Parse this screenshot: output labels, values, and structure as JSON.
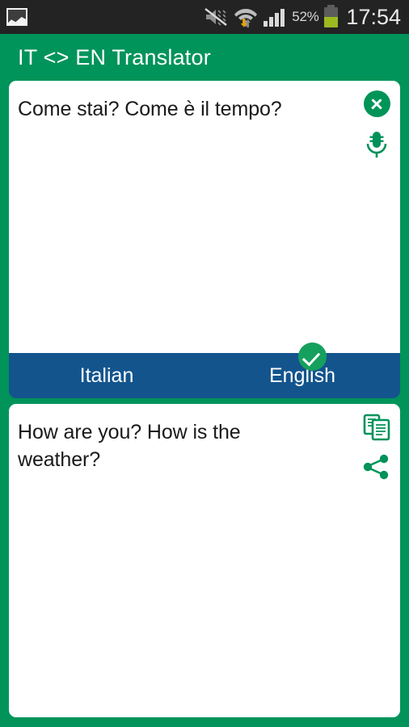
{
  "status_bar": {
    "left_icons": [
      {
        "name": "gallery-icon",
        "label": "gallery"
      }
    ],
    "right_icons": [
      {
        "name": "sound-muted-vibrate-icon",
        "label": "sound off / vibrate"
      },
      {
        "name": "wifi-data-transfer-icon",
        "label": "wifi with up and down arrows"
      },
      {
        "name": "cellular-signal-icon",
        "label": "signal bars"
      }
    ],
    "battery_percent": "52%",
    "battery_level": 52,
    "time": "17:54",
    "background_color": "#232323"
  },
  "app": {
    "title": "IT <> EN Translator",
    "brand_green": "#00945a",
    "accent_blue": "#13548d"
  },
  "input_card": {
    "text": "Come stai? Come è il tempo?",
    "clear_button_label": "clear",
    "mic_button_label": "voice input"
  },
  "language_bar": {
    "source_language": "Italian",
    "target_language": "English",
    "selected": "English",
    "check_badge_label": "selected"
  },
  "output_card": {
    "text": "How are you? How is the weather?",
    "copy_button_label": "copy",
    "share_button_label": "share"
  }
}
